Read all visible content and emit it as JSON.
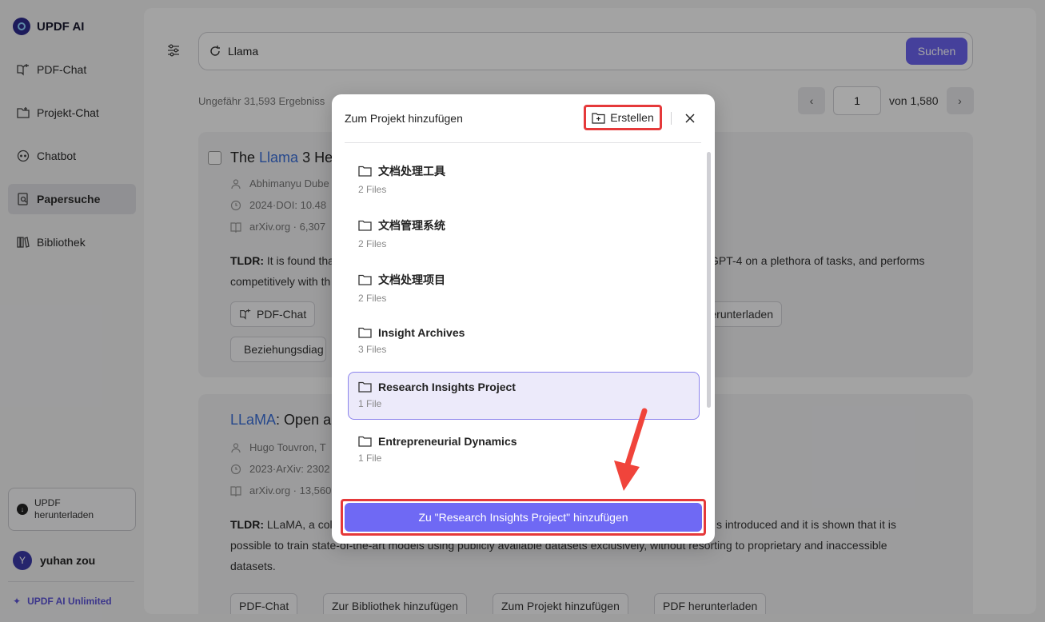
{
  "app": {
    "name": "UPDF AI"
  },
  "sidebar": {
    "items": [
      {
        "label": "PDF-Chat",
        "icon": "book-chat-icon"
      },
      {
        "label": "Projekt-Chat",
        "icon": "folder-chat-icon"
      },
      {
        "label": "Chatbot",
        "icon": "chatbot-icon"
      },
      {
        "label": "Papersuche",
        "icon": "paper-search-icon",
        "active": true
      },
      {
        "label": "Bibliothek",
        "icon": "library-icon"
      }
    ],
    "download_label_1": "UPDF",
    "download_label_2": "herunterladen",
    "user": {
      "initial": "Y",
      "name": "yuhan zou"
    },
    "plan": "UPDF AI Unlimited"
  },
  "search": {
    "value": "Llama",
    "button": "Suchen"
  },
  "results": {
    "count_text": "Ungefähr 31,593 Ergebniss",
    "page": "1",
    "of_text": "von 1,580"
  },
  "cards": [
    {
      "title_pre": "The ",
      "title_hl": "Llama",
      "title_post": " 3 He",
      "author": "Abhimanyu Dube",
      "doi": "2024·DOI: 10.48",
      "source": "arXiv.org · 6,307",
      "tldr_label": "TLDR:",
      "tldr_line1_a": " It is found tha",
      "tldr_line1_b": "GPT-4 on a plethora of tasks, and performs",
      "tldr_line2": "competitively with th",
      "chip_pdf": "PDF-Chat",
      "chip_dl": "herunterladen",
      "chip_rel": "Beziehungsdiag"
    },
    {
      "title_hl": "LLaMA",
      "title_post": ": Open a",
      "author": "Hugo Touvron,  T",
      "doi": "2023·ArXiv: 2302",
      "source": "arXiv.org · 13,560",
      "tldr_label": "TLDR:",
      "tldr_line1_a": " LLaMA, a coll",
      "tldr_line1_b": "s introduced and it is shown that it is",
      "tldr_line2": "possible to train state-of-the-art models using publicly available datasets exclusively, without resorting to proprietary and inaccessible",
      "tldr_line3": "datasets.",
      "chip_pdf": "PDF-Chat",
      "chip_lib": "Zur Bibliothek hinzufügen",
      "chip_proj": "Zum Projekt hinzufügen",
      "chip_dl": "PDF herunterladen"
    }
  ],
  "modal": {
    "title": "Zum Projekt hinzufügen",
    "create": "Erstellen",
    "folders": [
      {
        "name": "文档处理工具",
        "count": "2 Files"
      },
      {
        "name": "文档管理系统",
        "count": "2 Files"
      },
      {
        "name": "文档处理项目",
        "count": "2 Files"
      },
      {
        "name": "Insight Archives",
        "count": "3 Files"
      },
      {
        "name": "Research Insights Project",
        "count": "1 File",
        "selected": true
      },
      {
        "name": "Entrepreneurial Dynamics",
        "count": "1 File"
      }
    ],
    "add_button": "Zu \"Research Insights Project\" hinzufügen"
  },
  "colors": {
    "accent": "#6b63ee",
    "highlight": "#e5393a",
    "link": "#3b6fd8"
  }
}
